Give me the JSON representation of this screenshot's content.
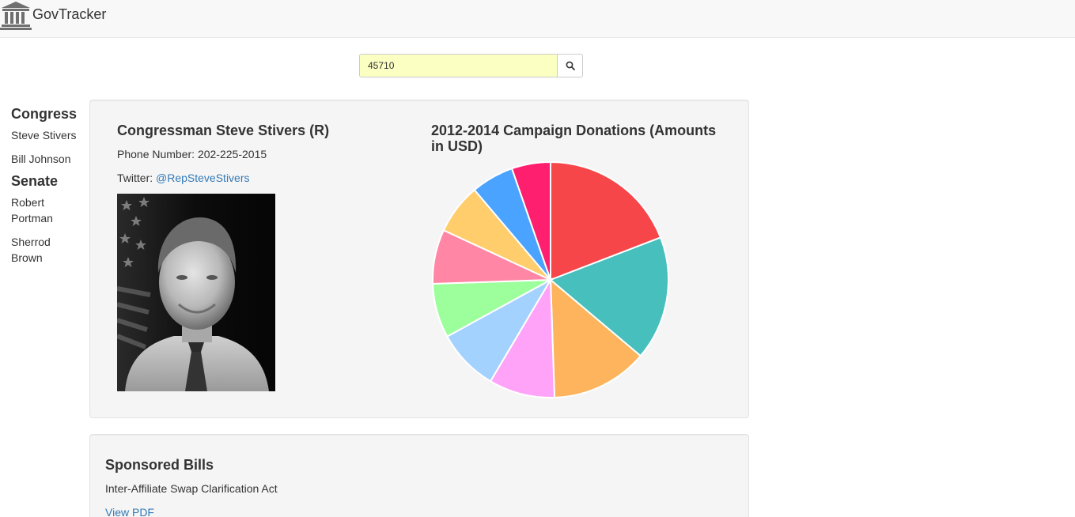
{
  "app": {
    "brand": "GovTracker"
  },
  "search": {
    "value": "45710"
  },
  "sidebar": {
    "congress_heading": "Congress",
    "congress_members": [
      "Steve Stivers",
      "Bill Johnson"
    ],
    "senate_heading": "Senate",
    "senate_members": [
      "Robert Portman",
      "Sherrod Brown"
    ]
  },
  "profile": {
    "name": "Congressman Steve Stivers (R)",
    "phone_label": "Phone Number:",
    "phone": "202-225-2015",
    "twitter_label": "Twitter:",
    "twitter": "@RepSteveStivers"
  },
  "donations": {
    "title": "2012-2014 Campaign Donations (Amounts in USD)"
  },
  "chart_data": {
    "type": "pie",
    "title": "2012-2014 Campaign Donations (Amounts in USD)",
    "values": [
      18,
      16,
      12.5,
      8.5,
      8,
      7,
      7,
      6.5,
      5.5,
      5
    ],
    "colors": [
      "#f7464a",
      "#46bfbd",
      "#fdb45c",
      "#ffa3f8",
      "#a3d2ff",
      "#9cff9c",
      "#ff87a5",
      "#ffcd6b",
      "#4aa3ff",
      "#ff1f6f"
    ]
  },
  "bills": {
    "heading": "Sponsored Bills",
    "items": [
      {
        "name": "Inter-Affiliate Swap Clarification Act",
        "link_label": "View PDF"
      }
    ]
  }
}
